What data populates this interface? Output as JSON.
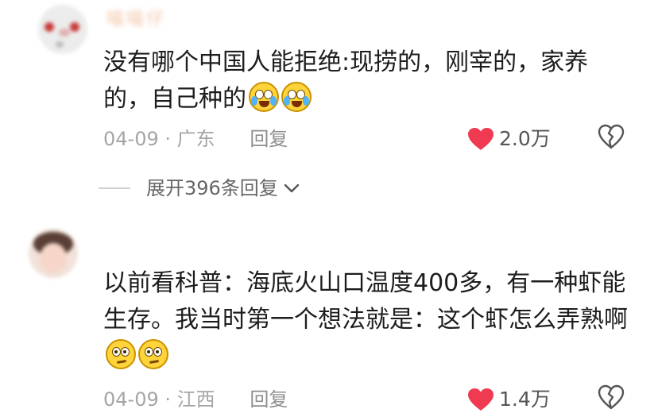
{
  "comments": [
    {
      "username": "喵喵仔",
      "text": "没有哪个中国人能拒绝:现捞的，刚宰的，家养的，自己种的",
      "emojis": [
        "crying-laugh-emoji",
        "crying-laugh-emoji"
      ],
      "date": "04-09",
      "separator": "·",
      "location": "广东",
      "reply_label": "回复",
      "likes": "2.0万",
      "expand_label": "展开396条回复"
    },
    {
      "username": "",
      "text": "以前看科普：海底火山口温度400多，有一种虾能生存。我当时第一个想法就是：这个虾怎么弄熟啊",
      "emojis": [
        "thinking-face-emoji",
        "thinking-face-emoji"
      ],
      "date": "04-09",
      "separator": "·",
      "location": "江西",
      "reply_label": "回复",
      "likes": "1.4万"
    }
  ],
  "colors": {
    "like_heart": "#f03a52",
    "meta_text": "#a5a5a5",
    "body_text": "#1d1d1d"
  },
  "icons": {
    "like": "heart-icon",
    "dislike": "broken-heart-icon",
    "expand": "chevron-down-icon"
  }
}
